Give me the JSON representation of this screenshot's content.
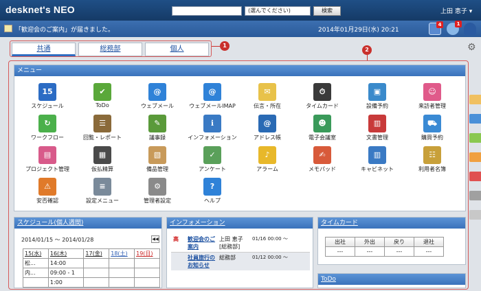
{
  "header": {
    "logo": "desknet's NEO",
    "search_placeholder": "",
    "select_value": "(選んでください)",
    "search_button": "検索",
    "user_name": "上田 恵子"
  },
  "notice": {
    "message": "「歓迎会のご案内」が届きました。",
    "datetime": "2014年01月29日(水) 20:21",
    "badges": {
      "info": "4",
      "mail": "1"
    }
  },
  "tabs": [
    "共通",
    "総務部",
    "個人"
  ],
  "callouts": [
    "1",
    "2"
  ],
  "menu": {
    "title": "メニュー",
    "items": [
      {
        "label": "スケジュール",
        "icon": "calendar-icon",
        "color": "#2c6cc4"
      },
      {
        "label": "ToDo",
        "icon": "todo-icon",
        "color": "#5aa83a"
      },
      {
        "label": "ウェブメール",
        "icon": "webmail-icon",
        "color": "#2f82d8"
      },
      {
        "label": "ウェブメールIMAP",
        "icon": "webmail-imap-icon",
        "color": "#2f82d8"
      },
      {
        "label": "伝言・所在",
        "icon": "message-icon",
        "color": "#e8c24a"
      },
      {
        "label": "タイムカード",
        "icon": "timecard-icon",
        "color": "#3a3a3a"
      },
      {
        "label": "設備予約",
        "icon": "facility-icon",
        "color": "#3a8acb"
      },
      {
        "label": "来訪者管理",
        "icon": "visitor-icon",
        "color": "#e05a8a"
      },
      {
        "label": "ワークフロー",
        "icon": "workflow-icon",
        "color": "#4bb04b"
      },
      {
        "label": "回覧・レポート",
        "icon": "report-icon",
        "color": "#8a6a3a"
      },
      {
        "label": "議事録",
        "icon": "minutes-icon",
        "color": "#5a9a3a"
      },
      {
        "label": "インフォメーション",
        "icon": "information-icon",
        "color": "#3a7ac4"
      },
      {
        "label": "アドレス帳",
        "icon": "address-icon",
        "color": "#2a6ab4"
      },
      {
        "label": "電子会議室",
        "icon": "conference-icon",
        "color": "#3a9a5a"
      },
      {
        "label": "文書管理",
        "icon": "document-icon",
        "color": "#c83a3a"
      },
      {
        "label": "購買予約",
        "icon": "purchase-icon",
        "color": "#3a8ad4"
      },
      {
        "label": "プロジェクト管理",
        "icon": "project-icon",
        "color": "#d85a8a"
      },
      {
        "label": "仮払精算",
        "icon": "expense-icon",
        "color": "#4a4a4a"
      },
      {
        "label": "備品管理",
        "icon": "equipment-icon",
        "color": "#c89a5a"
      },
      {
        "label": "アンケート",
        "icon": "survey-icon",
        "color": "#5aa05a"
      },
      {
        "label": "アラーム",
        "icon": "alarm-icon",
        "color": "#e8b82a"
      },
      {
        "label": "メモパッド",
        "icon": "memo-icon",
        "color": "#d85a3a"
      },
      {
        "label": "キャビネット",
        "icon": "cabinet-icon",
        "color": "#3a7ac4"
      },
      {
        "label": "利用者名簿",
        "icon": "directory-icon",
        "color": "#c8a03a"
      },
      {
        "label": "安否確認",
        "icon": "safety-icon",
        "color": "#e07a2a"
      },
      {
        "label": "設定メニュー",
        "icon": "settings-menu-icon",
        "color": "#7a8a9a"
      },
      {
        "label": "管理者設定",
        "icon": "admin-gear-icon",
        "color": "#8a8a8a"
      },
      {
        "label": "ヘルプ",
        "icon": "help-icon",
        "color": "#2f82d8"
      }
    ]
  },
  "schedule": {
    "title": "スケジュール(個人週間)",
    "range": "2014/01/15 〜 2014/01/28",
    "nav": "◀◀",
    "days": [
      "15(水)",
      "16(木)",
      "17(金)",
      "18(土)",
      "19(日)"
    ],
    "rows": [
      [
        "松...",
        "14:00",
        "",
        "",
        ""
      ],
      [
        "内...",
        "09:00 - 1",
        "",
        "",
        ""
      ],
      [
        "",
        "1:00",
        "",
        "",
        ""
      ]
    ]
  },
  "information": {
    "title": "インフォメーション",
    "items": [
      {
        "priority": "高",
        "title": "歓迎会のご案内",
        "author": "上田 恵子 [総務部]",
        "date": "01/16 00:00 〜"
      },
      {
        "priority": "",
        "title": "社員旅行のお知らせ",
        "author": "総務部",
        "date": "01/12 00:00 〜"
      }
    ]
  },
  "timecard": {
    "title": "タイムカード",
    "buttons": [
      "出社",
      "外出",
      "戻り",
      "退社"
    ],
    "values": [
      "---",
      "---",
      "---",
      "---"
    ]
  },
  "todo": {
    "title": "ToDo"
  },
  "right_strip_colors": [
    "#f0c060",
    "#4a90d8",
    "#8ac850",
    "#f0a040",
    "#e05050",
    "#a0a0a0",
    "#c8c8c8"
  ]
}
